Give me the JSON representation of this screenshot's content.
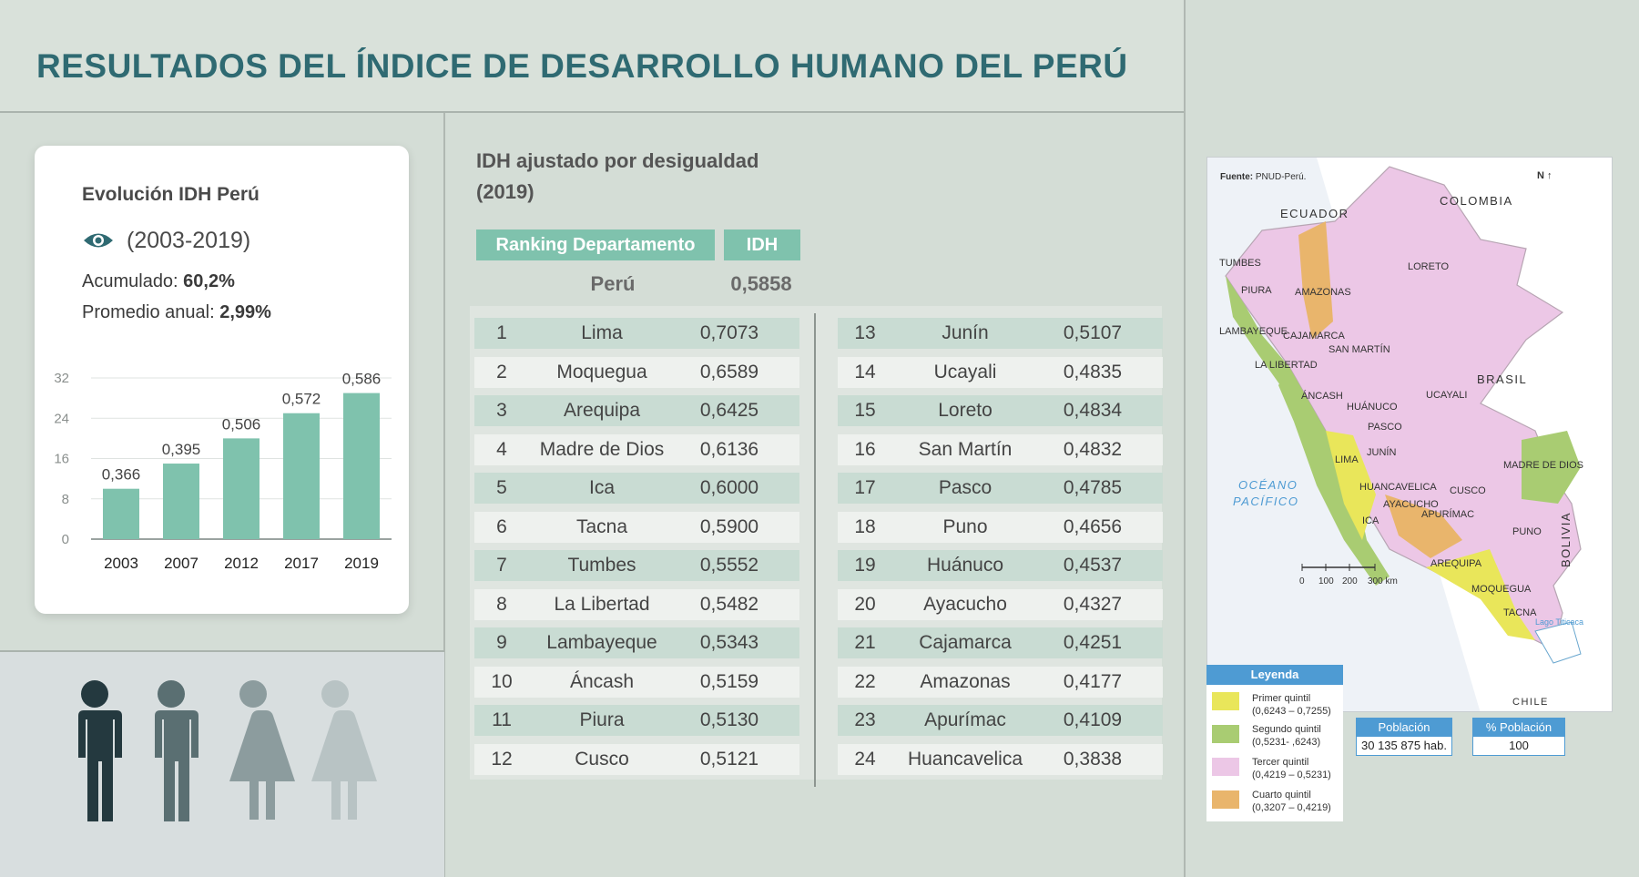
{
  "title": "RESULTADOS DEL ÍNDICE DE DESARROLLO HUMANO DEL PERÚ",
  "card": {
    "title": "Evolución IDH Perú",
    "period": "(2003-2019)",
    "accumulated_label": "Acumulado: ",
    "accumulated_value": "60,2%",
    "annual_label": "Promedio anual: ",
    "annual_value": "2,99%"
  },
  "chart_data": {
    "type": "bar",
    "categories": [
      "2003",
      "2007",
      "2012",
      "2017",
      "2019"
    ],
    "values": [
      10,
      15,
      20,
      25,
      29
    ],
    "data_labels": [
      "0,366",
      "0,395",
      "0,506",
      "0,572",
      "0,586"
    ],
    "yticks": [
      0,
      8,
      16,
      24,
      32
    ],
    "ylim": [
      0,
      32
    ],
    "color": "#7fc2ad",
    "grid": true
  },
  "people": {
    "colors": [
      "#24393f",
      "#5a6f72",
      "#8c9c9e",
      "#b8c3c4"
    ]
  },
  "table": {
    "title_line1": "IDH ajustado por desigualdad",
    "title_line2": "(2019)",
    "header_rank": "Ranking Departamento",
    "header_idh": "IDH",
    "peru_name": "Perú",
    "peru_value": "0,5858",
    "left_rows": [
      {
        "rank": "1",
        "name": "Lima",
        "value": "0,7073"
      },
      {
        "rank": "2",
        "name": "Moquegua",
        "value": "0,6589"
      },
      {
        "rank": "3",
        "name": "Arequipa",
        "value": "0,6425"
      },
      {
        "rank": "4",
        "name": "Madre de Dios",
        "value": "0,6136"
      },
      {
        "rank": "5",
        "name": "Ica",
        "value": "0,6000"
      },
      {
        "rank": "6",
        "name": "Tacna",
        "value": "0,5900"
      },
      {
        "rank": "7",
        "name": "Tumbes",
        "value": "0,5552"
      },
      {
        "rank": "8",
        "name": "La Libertad",
        "value": "0,5482"
      },
      {
        "rank": "9",
        "name": "Lambayeque",
        "value": "0,5343"
      },
      {
        "rank": "10",
        "name": "Áncash",
        "value": "0,5159"
      },
      {
        "rank": "11",
        "name": "Piura",
        "value": "0,5130"
      },
      {
        "rank": "12",
        "name": "Cusco",
        "value": "0,5121"
      }
    ],
    "right_rows": [
      {
        "rank": "13",
        "name": "Junín",
        "value": "0,5107"
      },
      {
        "rank": "14",
        "name": "Ucayali",
        "value": "0,4835"
      },
      {
        "rank": "15",
        "name": "Loreto",
        "value": "0,4834"
      },
      {
        "rank": "16",
        "name": "San Martín",
        "value": "0,4832"
      },
      {
        "rank": "17",
        "name": "Pasco",
        "value": "0,4785"
      },
      {
        "rank": "18",
        "name": "Puno",
        "value": "0,4656"
      },
      {
        "rank": "19",
        "name": "Huánuco",
        "value": "0,4537"
      },
      {
        "rank": "20",
        "name": "Ayacucho",
        "value": "0,4327"
      },
      {
        "rank": "21",
        "name": "Cajamarca",
        "value": "0,4251"
      },
      {
        "rank": "22",
        "name": "Amazonas",
        "value": "0,4177"
      },
      {
        "rank": "23",
        "name": "Apurímac",
        "value": "0,4109"
      },
      {
        "rank": "24",
        "name": "Huancavelica",
        "value": "0,3838"
      }
    ]
  },
  "map": {
    "source_label": "Fuente:",
    "source_value": " PNUD-Perú.",
    "north": "N",
    "countries": {
      "ecuador": "ECUADOR",
      "colombia": "COLOMBIA",
      "brasil": "BRASIL",
      "bolivia": "BOLIVIA",
      "chile": "CHILE"
    },
    "ocean_line1": "OCÉANO",
    "ocean_line2": "PACÍFICO",
    "lake": "Lago Titicaca",
    "regions": {
      "tumbes": "TUMBES",
      "piura": "PIURA",
      "amazonas": "AMAZONAS",
      "loreto": "LORETO",
      "lambayeque": "LAMBAYEQUE",
      "cajamarca": "CAJAMARCA",
      "san_martin": "SAN MARTÍN",
      "la_libertad": "LA LIBERTAD",
      "ancash": "ÁNCASH",
      "ucayali": "UCAYALI",
      "huanuco": "HUÁNUCO",
      "pasco": "PASCO",
      "junin": "JUNÍN",
      "lima": "LIMA",
      "madre_de_dios": "MADRE DE DIOS",
      "huancavelica": "HUANCAVELICA",
      "cusco": "CUSCO",
      "ayacucho": "AYACUCHO",
      "apurimac": "APURÍMAC",
      "ica": "ICA",
      "puno": "PUNO",
      "arequipa": "AREQUIPA",
      "moquegua": "MOQUEGUA",
      "tacna": "TACNA"
    },
    "scale_labels": [
      "0",
      "100",
      "200",
      "300 km"
    ],
    "legend_title": "Leyenda",
    "legend": [
      {
        "label": "Primer quintil",
        "range": "(0,6243 – 0,7255)",
        "color": "#e9e65a"
      },
      {
        "label": "Segundo quintil",
        "range": "(0,5231- ,6243)",
        "color": "#a9cc72"
      },
      {
        "label": "Tercer quintil",
        "range": "(0,4219 – 0,5231)",
        "color": "#ecc7e6"
      },
      {
        "label": "Cuarto quintil",
        "range": "(0,3207 – 0,4219)",
        "color": "#e9b56c"
      }
    ],
    "population_label": "Población",
    "population_value": "30 135 875 hab.",
    "pct_population_label": "% Población",
    "pct_population_value": "100"
  }
}
